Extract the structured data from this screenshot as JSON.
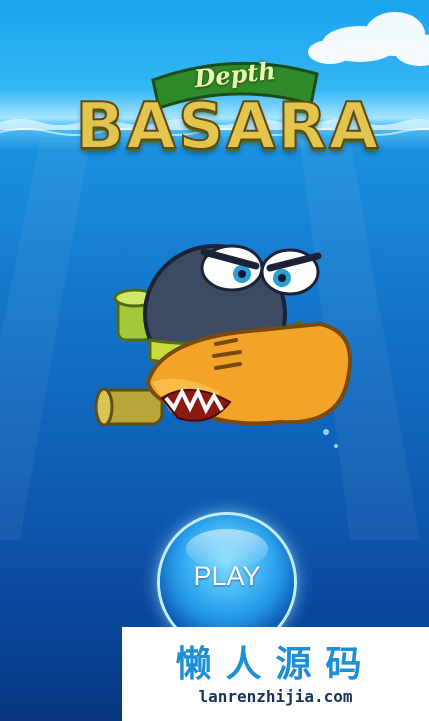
{
  "game": {
    "logo": {
      "subtitle": "Depth",
      "title": "BASARA"
    },
    "menu": {
      "play_label": "PLAY"
    },
    "character": "angry-submarine-fish"
  },
  "watermark": {
    "chinese": "懒人源码",
    "url": "lanrenzhijia.com"
  },
  "colors": {
    "ocean_top": "#35b7f5",
    "ocean_bottom": "#08367f",
    "logo_gold": "#e3c44e",
    "logo_green": "#4c6b1a",
    "play_button": "#2aa3ee",
    "watermark_blue": "#1c8fd6"
  }
}
